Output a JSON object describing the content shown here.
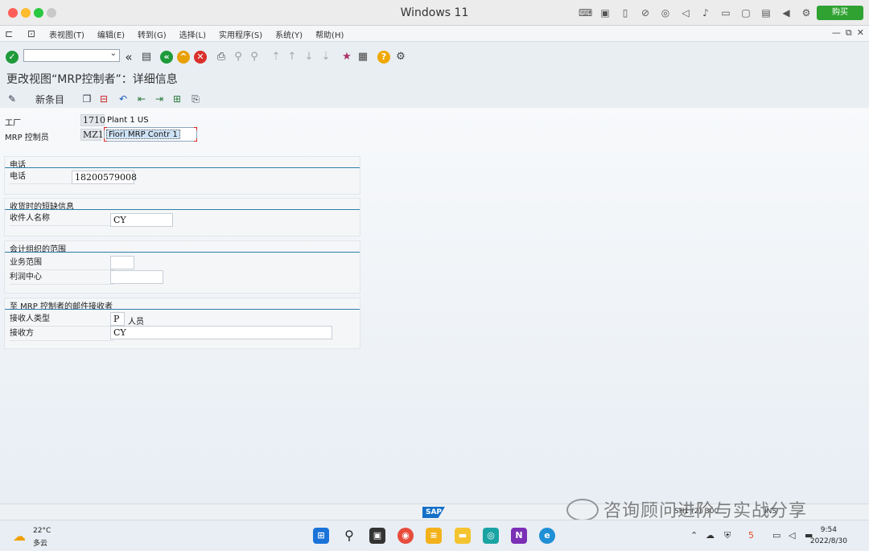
{
  "window": {
    "title": "Windows 11",
    "buy_label": "购买"
  },
  "menubar": {
    "items": [
      "表视图(T)",
      "编辑(E)",
      "转到(G)",
      "选择(L)",
      "实用程序(S)",
      "系统(Y)",
      "帮助(H)"
    ]
  },
  "page": {
    "title": "更改视图“MRP控制者”：详细信息"
  },
  "apptoolbar": {
    "new_entries": "新条目"
  },
  "header": {
    "plant_label": "工厂",
    "plant_code": "1710",
    "plant_name": "Plant 1 US",
    "mrp_label": "MRP 控制员",
    "mrp_code": "MZ1",
    "mrp_name": "Fiori MRP Contr 1"
  },
  "groups": {
    "phone": {
      "title": "电话",
      "label": "电话",
      "value": "18200579008"
    },
    "short": {
      "title": "收货时的短缺信息",
      "label": "收件人名称",
      "value": "CY"
    },
    "org": {
      "title": "会计组织的范围",
      "business_area_label": "业务范围",
      "business_area": "",
      "profit_center_label": "利润中心",
      "profit_center": ""
    },
    "mail": {
      "title": "至 MRP 控制者的邮件接收者",
      "type_label": "接收人类型",
      "type_value": "P",
      "type_text": "人员",
      "recipient_label": "接收方",
      "recipient_value": "CY"
    }
  },
  "statusbar": {
    "left_code": "SH1 (2)",
    "client": "300",
    "mode": "INS"
  },
  "watermark": "咨询顾问进阶与实战分享",
  "taskbar": {
    "temp": "22°C",
    "weather": "多云",
    "time": "9:54",
    "date": "2022/8/30"
  }
}
